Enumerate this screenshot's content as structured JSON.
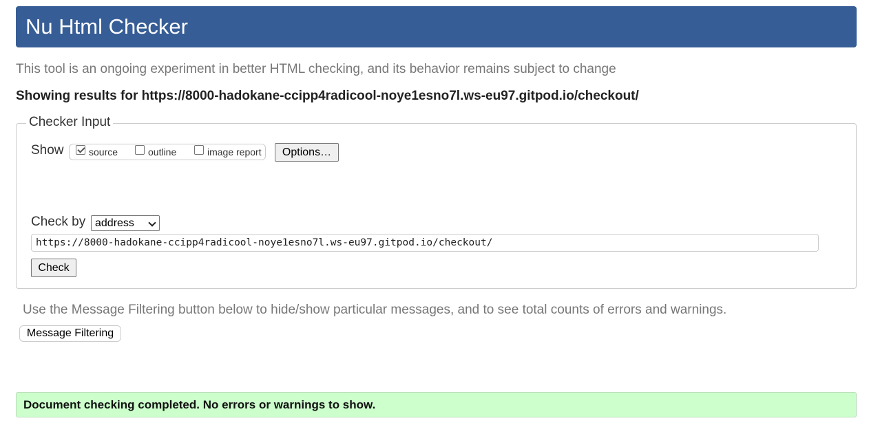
{
  "header": {
    "title": "Nu Html Checker"
  },
  "intro": {
    "subtitle": "This tool is an ongoing experiment in better HTML checking, and its behavior remains subject to change",
    "showing_prefix": "Showing results for ",
    "showing_url": "https://8000-hadokane-ccipp4radicool-noye1esno7l.ws-eu97.gitpod.io/checkout/"
  },
  "checker_input": {
    "legend": "Checker Input",
    "show_label": "Show",
    "options": [
      {
        "label": "source",
        "checked": true
      },
      {
        "label": "outline",
        "checked": false
      },
      {
        "label": "image report",
        "checked": false
      }
    ],
    "options_button": "Options…",
    "check_by_label": "Check by",
    "check_by_selected": "address",
    "url_value": "https://8000-hadokane-ccipp4radicool-noye1esno7l.ws-eu97.gitpod.io/checkout/",
    "check_button": "Check"
  },
  "filtering": {
    "hint": "Use the Message Filtering button below to hide/show particular messages, and to see total counts of errors and warnings.",
    "button": "Message Filtering"
  },
  "result": {
    "message": "Document checking completed. No errors or warnings to show."
  },
  "colors": {
    "header_bg": "#365d96",
    "success_bg": "#ccffcc"
  }
}
